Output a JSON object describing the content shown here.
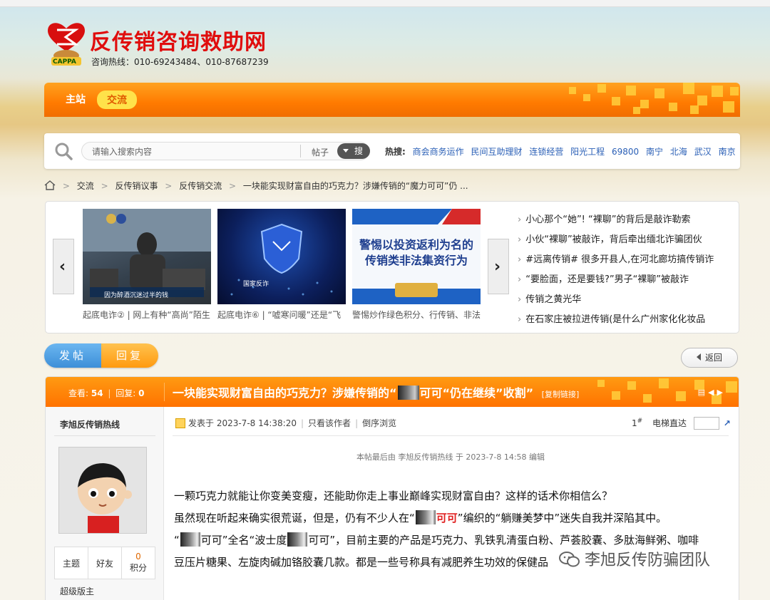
{
  "site": {
    "title": "反传销咨询救助网",
    "hotline": "咨询热线：010-69243484、010-87687239",
    "logo_text": "CAPPA"
  },
  "nav": {
    "main": "主站",
    "forum": "交流"
  },
  "search": {
    "placeholder": "请输入搜索内容",
    "type": "帖子",
    "button": "搜索",
    "hot_label": "热搜:",
    "hot_terms": [
      "商会商务运作",
      "民间互助理财",
      "连锁经营",
      "阳光工程",
      "69800",
      "南宁",
      "北海",
      "武汉",
      "南京"
    ]
  },
  "breadcrumb": [
    "交流",
    "反传销议事",
    "反传销交流",
    "一块能实现财富自由的巧克力？涉嫌传销的“魔力可可”仍 ..."
  ],
  "slides": [
    {
      "caption": "起底电诈② | 网上有种“高尚”陌生",
      "img_text": "因为醉酒沉迷过半的钱"
    },
    {
      "caption": "起底电诈⑥ | “嘘寒问暖”还是“飞",
      "img_text": "国家反诈"
    },
    {
      "caption": "警惕炒作绿色积分、行传销、非法",
      "img_text": "警惕以投资返利为名的传销类非法集资行为"
    }
  ],
  "news": [
    "小心那个“她”! “裸聊”的背后是敲诈勒索",
    "小伙“裸聊”被敲诈，背后牵出缅北诈骗团伙",
    "#远离传销# 很多开县人,在河北廊坊搞传销诈",
    "“要脸面，还是要钱?”男子“裸聊”被敲诈",
    "传销之黄光华",
    "在石家庄被拉进传销(是什么广州家化化妆品"
  ],
  "actions": {
    "post": "发帖",
    "reply": "回复",
    "back": "返回"
  },
  "thread": {
    "views_label": "查看:",
    "views": "54",
    "replies_label": "回复:",
    "replies": "0",
    "title_pre": "一块能实现财富自由的巧克力？涉嫌传销的“",
    "title_post": "可可“仍在继续”收割”",
    "copy_link": "[复制链接]"
  },
  "author": {
    "name": "李旭反传销热线",
    "stats": [
      {
        "label": "主题",
        "value": ""
      },
      {
        "label": "好友",
        "value": ""
      },
      {
        "label": "积分",
        "value": "0"
      }
    ],
    "role": "超级版主"
  },
  "post": {
    "posted": "发表于 2023-7-8 14:38:20",
    "only_author": "只看该作者",
    "reverse": "倒序浏览",
    "floor": "1",
    "elevator": "电梯直达",
    "edited": "本帖最后由 李旭反传销热线 于 2023-7-8 14:58 编辑",
    "p1": "一颗巧克力就能让你变美变瘦，还能助你走上事业巅峰实现财富自由？这样的话术你相信么？",
    "p2a": "虽然现在听起来确实很荒诞，但是，仍有不少人在“",
    "p2b": "可可",
    "p2c": "”编织的“躺赚美梦中”迷失自我并深陷其中。",
    "p3a": "“",
    "p3b": "可可”全名“波士度",
    "p3c": "可可”，目前主要的产品是巧克力、乳铁乳清蛋白粉、芦荟胶囊、多肽海鲜粥、咖啡",
    "p4": "豆压片糖果、左旋肉碱加铬胶囊几款。都是一些号称具有减肥养生功效的保健品"
  },
  "watermark": "李旭反传防骗团队",
  "colors": {
    "accent": "#ff7a00",
    "brand_red": "#e00d0d",
    "link": "#2a5fb6"
  }
}
